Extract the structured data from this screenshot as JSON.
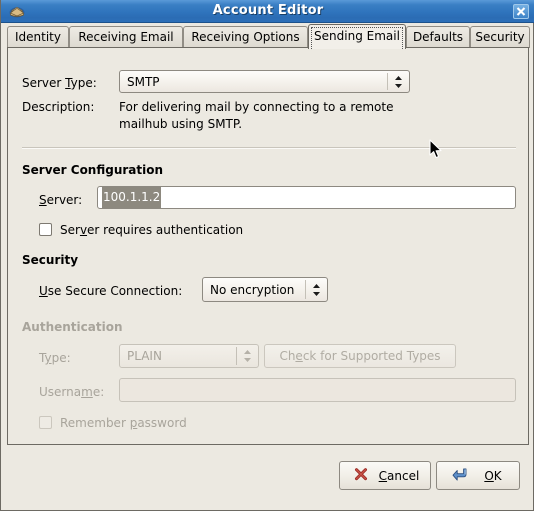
{
  "window": {
    "title": "Account Editor",
    "icon": "mail-envelope-icon",
    "close_label": "✕"
  },
  "tabs": [
    {
      "label": "Identity",
      "active": false
    },
    {
      "label": "Receiving Email",
      "active": false
    },
    {
      "label": "Receiving Options",
      "active": false
    },
    {
      "label": "Sending Email",
      "active": true
    },
    {
      "label": "Defaults",
      "active": false
    },
    {
      "label": "Security",
      "active": false
    }
  ],
  "sending_email": {
    "server_type": {
      "label": "Server Type:",
      "value": "SMTP"
    },
    "description": {
      "label": "Description:",
      "line1": "For delivering mail by connecting to a remote",
      "line2": "mailhub using SMTP."
    },
    "server_configuration": {
      "heading": "Server Configuration",
      "server": {
        "label": "Server:",
        "value": "100.1.1.2",
        "selected": true
      },
      "requires_auth": {
        "label": "Server requires authentication",
        "checked": false
      }
    },
    "security": {
      "heading": "Security",
      "secure_connection": {
        "label": "Use Secure Connection:",
        "value": "No encryption"
      }
    },
    "authentication": {
      "heading": "Authentication",
      "enabled": false,
      "type": {
        "label": "Type:",
        "value": "PLAIN"
      },
      "check_supported": {
        "label": "Check for Supported Types"
      },
      "username": {
        "label": "Username:",
        "value": ""
      },
      "remember_password": {
        "label": "Remember password",
        "checked": false
      }
    }
  },
  "actions": {
    "cancel": {
      "label": "Cancel",
      "icon": "close-x-icon"
    },
    "ok": {
      "label": "OK",
      "icon": "enter-arrow-icon"
    }
  },
  "colors": {
    "titlebar_start": "#5a9ad8",
    "titlebar_end": "#2c6fb8",
    "dialog_bg": "#ece9e1",
    "cancel_icon": "#9e2b25",
    "ok_icon": "#4a7fc1",
    "selection_bg": "#8d897f",
    "disabled_text": "#a8a49b"
  }
}
